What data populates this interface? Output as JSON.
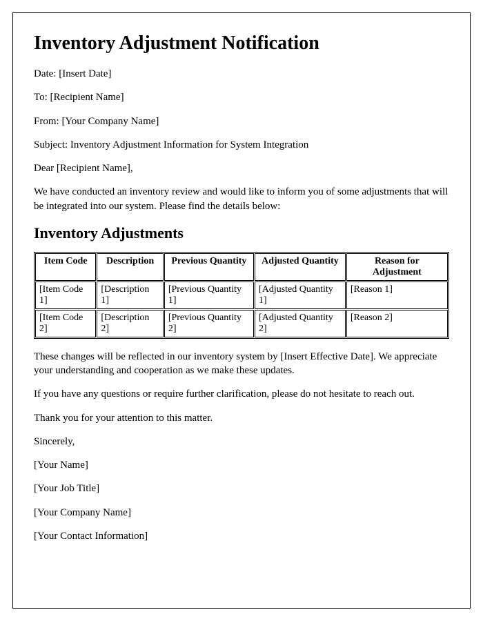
{
  "title": "Inventory Adjustment Notification",
  "meta": {
    "date_label": "Date: ",
    "date_value": "[Insert Date]",
    "to_label": "To: ",
    "to_value": "[Recipient Name]",
    "from_label": "From: ",
    "from_value": "[Your Company Name]",
    "subject_label": "Subject: ",
    "subject_value": "Inventory Adjustment Information for System Integration"
  },
  "salutation": "Dear [Recipient Name],",
  "intro": "We have conducted an inventory review and would like to inform you of some adjustments that will be integrated into our system. Please find the details below:",
  "section_heading": "Inventory Adjustments",
  "table": {
    "headers": {
      "item_code": "Item Code",
      "description": "Description",
      "previous_qty": "Previous Quantity",
      "adjusted_qty": "Adjusted Quantity",
      "reason": "Reason for Adjustment"
    },
    "rows": [
      {
        "item_code": "[Item Code 1]",
        "description": "[Description 1]",
        "previous_qty": "[Previous Quantity 1]",
        "adjusted_qty": "[Adjusted Quantity 1]",
        "reason": "[Reason 1]"
      },
      {
        "item_code": "[Item Code 2]",
        "description": "[Description 2]",
        "previous_qty": "[Previous Quantity 2]",
        "adjusted_qty": "[Adjusted Quantity 2]",
        "reason": "[Reason 2]"
      }
    ]
  },
  "body": {
    "effective": "These changes will be reflected in our inventory system by [Insert Effective Date]. We appreciate your understanding and cooperation as we make these updates.",
    "questions": "If you have any questions or require further clarification, please do not hesitate to reach out.",
    "thanks": "Thank you for your attention to this matter."
  },
  "closing": {
    "sincerely": "Sincerely,",
    "name": "[Your Name]",
    "job_title": "[Your Job Title]",
    "company": "[Your Company Name]",
    "contact": "[Your Contact Information]"
  }
}
